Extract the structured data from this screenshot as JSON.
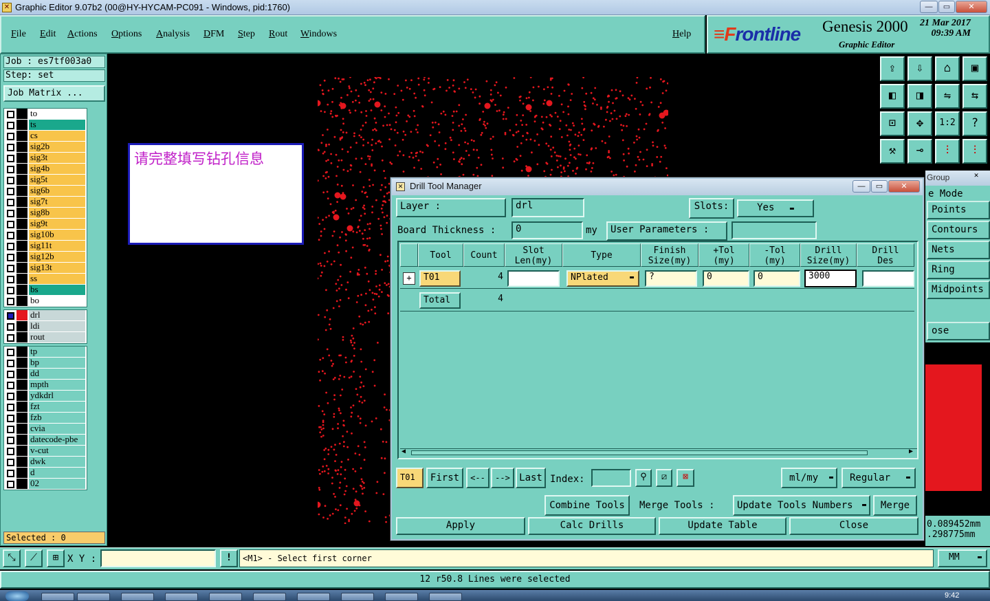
{
  "window": {
    "title": "Graphic Editor 9.07b2 (00@HY-HYCAM-PC091 - Windows, pid:1760)",
    "min": "—",
    "max": "▭",
    "close": "✕"
  },
  "menu": {
    "items": [
      "File",
      "Edit",
      "Actions",
      "Options",
      "Analysis",
      "DFM",
      "Step",
      "Rout",
      "Windows"
    ],
    "help": "Help"
  },
  "brand": {
    "logo_f": "≡F",
    "logo_rest": "rontline",
    "name": "Genesis 2000",
    "subtitle": "Graphic Editor",
    "date": "21 Mar 2017",
    "time": "09:39 AM"
  },
  "left": {
    "job": "Job  : es7tf003a0",
    "step": "Step: set",
    "job_matrix": "Job Matrix ...",
    "layers_board": [
      {
        "name": "to",
        "color": "#ffffff"
      },
      {
        "name": "ts",
        "color": "#1aa88c"
      },
      {
        "name": "cs",
        "color": "#f8c44a"
      },
      {
        "name": "sig2b",
        "color": "#f8c44a"
      },
      {
        "name": "sig3t",
        "color": "#f8c44a"
      },
      {
        "name": "sig4b",
        "color": "#f8c44a"
      },
      {
        "name": "sig5t",
        "color": "#f8c44a"
      },
      {
        "name": "sig6b",
        "color": "#f8c44a"
      },
      {
        "name": "sig7t",
        "color": "#f8c44a"
      },
      {
        "name": "sig8b",
        "color": "#f8c44a"
      },
      {
        "name": "sig9t",
        "color": "#f8c44a"
      },
      {
        "name": "sig10b",
        "color": "#f8c44a"
      },
      {
        "name": "sig11t",
        "color": "#f8c44a"
      },
      {
        "name": "sig12b",
        "color": "#f8c44a"
      },
      {
        "name": "sig13t",
        "color": "#f8c44a"
      },
      {
        "name": "ss",
        "color": "#f8c44a"
      },
      {
        "name": "bs",
        "color": "#1aa88c"
      },
      {
        "name": "bo",
        "color": "#ffffff"
      }
    ],
    "layers_drill": [
      {
        "name": "drl",
        "color": "#c8d8d8"
      },
      {
        "name": "ldi",
        "color": "#c8d8d8"
      },
      {
        "name": "rout",
        "color": "#c8d8d8"
      }
    ],
    "layers_misc": [
      {
        "name": "tp",
        "color": "#78d0c0"
      },
      {
        "name": "bp",
        "color": "#78d0c0"
      },
      {
        "name": "dd",
        "color": "#78d0c0"
      },
      {
        "name": "mpth",
        "color": "#78d0c0"
      },
      {
        "name": "ydkdrl",
        "color": "#78d0c0"
      },
      {
        "name": "fzt",
        "color": "#78d0c0"
      },
      {
        "name": "fzb",
        "color": "#78d0c0"
      },
      {
        "name": "cvia",
        "color": "#78d0c0"
      },
      {
        "name": "datecode-pbe",
        "color": "#78d0c0"
      },
      {
        "name": "v-cut",
        "color": "#78d0c0"
      },
      {
        "name": "dwk",
        "color": "#78d0c0"
      },
      {
        "name": "d",
        "color": "#78d0c0"
      },
      {
        "name": "02",
        "color": "#78d0c0"
      }
    ],
    "selected": "Selected : 0"
  },
  "note": "请完整填写钻孔信息",
  "snap": {
    "title_frag": "Group",
    "mode": "e Mode",
    "items": [
      "Points",
      "Contours",
      "Nets",
      "Ring",
      "Midpoints"
    ],
    "close": "ose"
  },
  "readout": {
    "x": "0.089452mm",
    "y": ".298775mm"
  },
  "dtm": {
    "title": "Drill Tool Manager",
    "layer_label": "Layer          :",
    "layer_value": "drl",
    "slots_label": "Slots:",
    "slots_value": "Yes",
    "board_thickness_label": "Board Thickness :",
    "board_thickness_value": "0",
    "unit": "my",
    "user_params_label": "User Parameters :",
    "user_params_value": "",
    "columns": [
      "Tool",
      "Count",
      "Slot\nLen(my)",
      "Type",
      "Finish\nSize(my)",
      "+Tol\n(my)",
      "-Tol\n(my)",
      "Drill\nSize(my)",
      "Drill\nDes"
    ],
    "rows": [
      {
        "tool": "T01",
        "count": "4",
        "slot_len": "",
        "type": "NPlated",
        "finish": "?",
        "ptol": "0",
        "mtol": "0",
        "drill_size": "3000",
        "drill_des": ""
      }
    ],
    "total_label": "Total",
    "total_count": "4",
    "current_tool": "T01",
    "first": "First",
    "prev": "<--",
    "next": "-->",
    "last": "Last",
    "index_label": "Index:",
    "index_value": "",
    "units_sel": "ml/my",
    "mode_sel": "Regular",
    "combine": "Combine Tools",
    "merge_tools_label": "Merge Tools :",
    "update_numbers": "Update Tools Numbers",
    "merge": "Merge",
    "apply": "Apply",
    "calc": "Calc Drills",
    "update_table": "Update Table",
    "close": "Close"
  },
  "status": {
    "xy_label": "X Y :",
    "xy_value": "",
    "prompt": "<M1> - Select first corner",
    "units": "MM",
    "message": "12 r50.8 Lines were selected"
  },
  "taskbar": {
    "clock": "9:42"
  }
}
